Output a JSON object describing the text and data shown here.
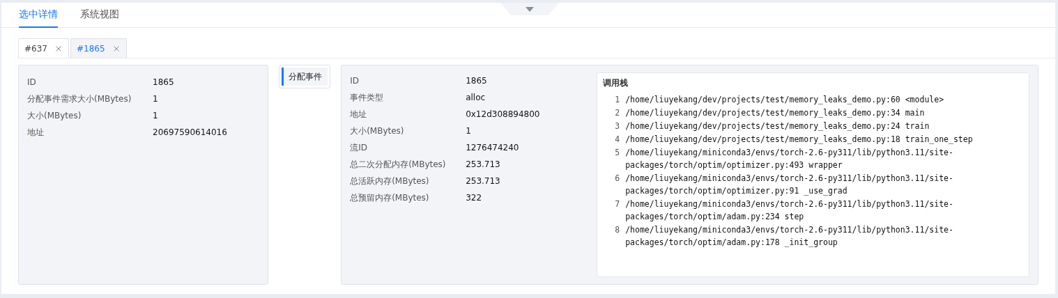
{
  "tabs": [
    {
      "label": "选中详情",
      "selected": true
    },
    {
      "label": "系统视图",
      "selected": false
    }
  ],
  "item_tabs": [
    {
      "label": "#637",
      "selected": false
    },
    {
      "label": "#1865",
      "selected": true
    }
  ],
  "details": [
    {
      "label": "ID",
      "value": "1865"
    },
    {
      "label": "分配事件需求大小(MBytes)",
      "value": "1"
    },
    {
      "label": "大小(MBytes)",
      "value": "1"
    },
    {
      "label": "地址",
      "value": "20697590614016"
    }
  ],
  "event_nav": [
    {
      "label": "分配事件",
      "selected": true
    }
  ],
  "event_details": [
    {
      "label": "ID",
      "value": "1865"
    },
    {
      "label": "事件类型",
      "value": "alloc"
    },
    {
      "label": "地址",
      "value": "0x12d308894800"
    },
    {
      "label": "大小(MBytes)",
      "value": "1"
    },
    {
      "label": "流ID",
      "value": "1276474240"
    },
    {
      "label": "总二次分配内存(MBytes)",
      "value": "253.713"
    },
    {
      "label": "总活跃内存(MBytes)",
      "value": "253.713"
    },
    {
      "label": "总预留内存(MBytes)",
      "value": "322"
    }
  ],
  "call_stack": {
    "title": "调用栈",
    "frames": [
      {
        "index": "1",
        "text": "/home/liuyekang/dev/projects/test/memory_leaks_demo.py:60 <module>"
      },
      {
        "index": "2",
        "text": "/home/liuyekang/dev/projects/test/memory_leaks_demo.py:34 main"
      },
      {
        "index": "3",
        "text": "/home/liuyekang/dev/projects/test/memory_leaks_demo.py:24 train"
      },
      {
        "index": "4",
        "text": "/home/liuyekang/dev/projects/test/memory_leaks_demo.py:18 train_one_step"
      },
      {
        "index": "5",
        "text": "/home/liuyekang/miniconda3/envs/torch-2.6-py311/lib/python3.11/site-packages/torch/optim/optimizer.py:493 wrapper"
      },
      {
        "index": "6",
        "text": "/home/liuyekang/miniconda3/envs/torch-2.6-py311/lib/python3.11/site-packages/torch/optim/optimizer.py:91 _use_grad"
      },
      {
        "index": "7",
        "text": "/home/liuyekang/miniconda3/envs/torch-2.6-py311/lib/python3.11/site-packages/torch/optim/adam.py:234 step"
      },
      {
        "index": "8",
        "text": "/home/liuyekang/miniconda3/envs/torch-2.6-py311/lib/python3.11/site-packages/torch/optim/adam.py:178 _init_group"
      }
    ]
  }
}
